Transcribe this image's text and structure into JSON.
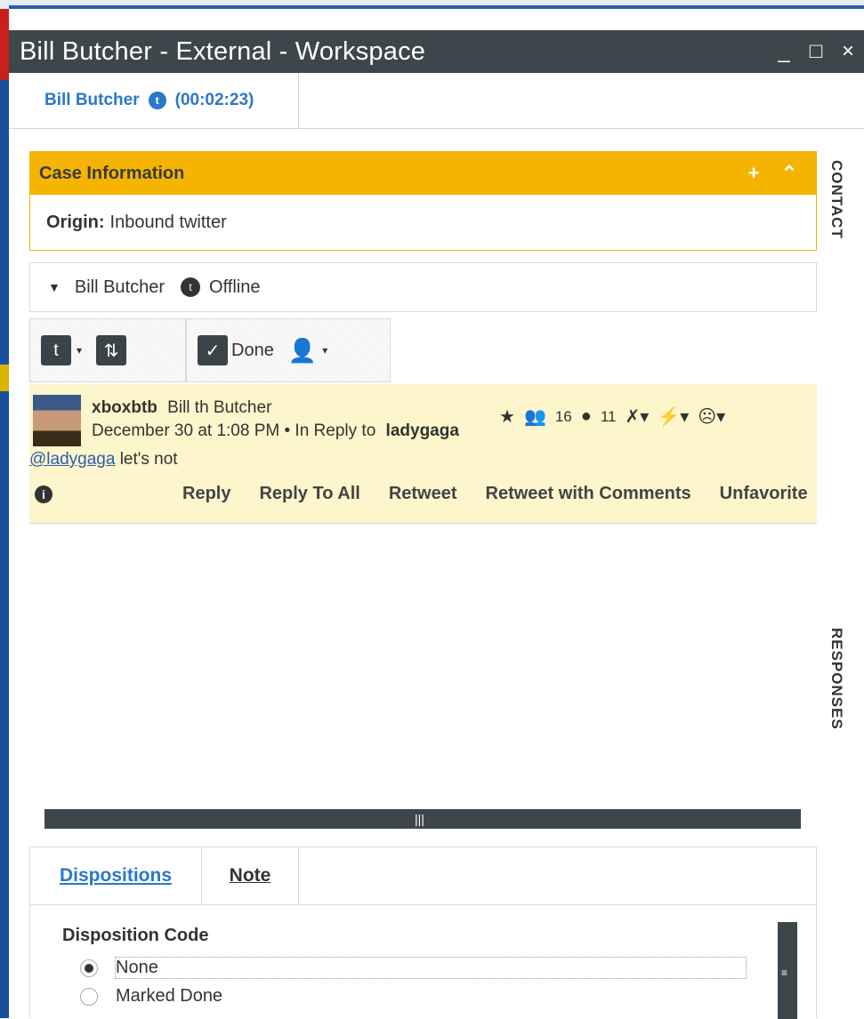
{
  "window": {
    "title": "Bill Butcher - External - Workspace",
    "minimize": "_",
    "maximize": "□",
    "close": "×"
  },
  "interaction_tab": {
    "name": "Bill Butcher",
    "timer": "(00:02:23)",
    "icon": "twitter-icon"
  },
  "side_tabs": {
    "contact": "CONTACT",
    "responses": "RESPONSES"
  },
  "case": {
    "title": "Case Information",
    "add": "+",
    "collapse": "⌃",
    "origin_label": "Origin:",
    "origin_value": "Inbound twitter"
  },
  "party": {
    "caret": "▼",
    "name": "Bill Butcher",
    "status": "Offline"
  },
  "toolbar": {
    "done_label": "Done"
  },
  "tweet": {
    "handle": "xboxbtb",
    "display_name": "Bill th Butcher",
    "date": "December 30 at 1:08 PM",
    "reply_prefix": "• In Reply to",
    "reply_to": "ladygaga",
    "followers": "16",
    "tweets": "11",
    "mention": "@ladygaga",
    "text": " let's not",
    "actions": {
      "reply": "Reply",
      "reply_all": "Reply To All",
      "retweet": "Retweet",
      "retweet_comments": "Retweet with Comments",
      "unfavorite": "Unfavorite"
    }
  },
  "bottom_tabs": {
    "dispositions": "Dispositions",
    "note": "Note"
  },
  "dispositions": {
    "label": "Disposition Code",
    "options": [
      "None",
      "Marked Done"
    ],
    "selected": "None"
  }
}
